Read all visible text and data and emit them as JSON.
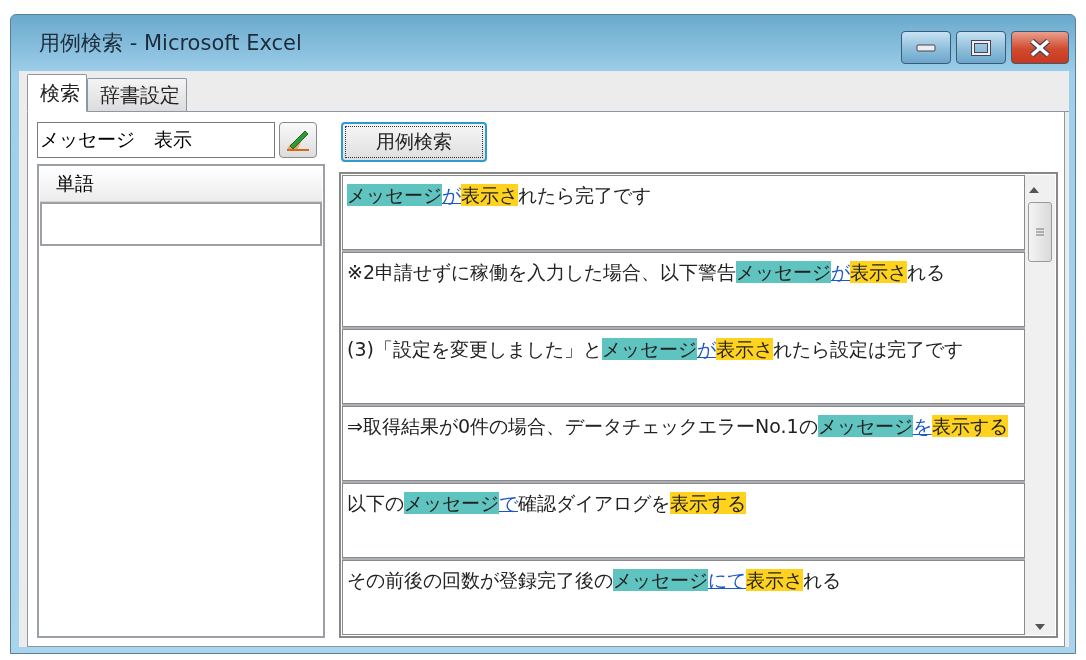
{
  "window": {
    "title": "用例検索 - Microsoft Excel"
  },
  "tabs": [
    {
      "label": "検索",
      "selected": true
    },
    {
      "label": "辞書設定",
      "selected": false
    }
  ],
  "search": {
    "value": "メッセージ　表示"
  },
  "search_button": "用例検索",
  "word_list": {
    "columns": [
      "単語"
    ],
    "rows": [
      {
        "word": "",
        "selected": false
      }
    ]
  },
  "results": [
    {
      "segments": [
        {
          "kind": "noun",
          "text": "メッセージ"
        },
        {
          "kind": "particle",
          "text": "が"
        },
        {
          "kind": "verb",
          "text": "表示さ"
        },
        {
          "kind": "plain",
          "text": "れたら完了です"
        }
      ]
    },
    {
      "segments": [
        {
          "kind": "plain",
          "text": "※2申請せずに稼働を入力した場合、以下警告"
        },
        {
          "kind": "noun",
          "text": "メッセージ"
        },
        {
          "kind": "particle",
          "text": "が"
        },
        {
          "kind": "verb",
          "text": "表示さ"
        },
        {
          "kind": "plain",
          "text": "れる"
        }
      ]
    },
    {
      "segments": [
        {
          "kind": "plain",
          "text": "(3)「設定を変更しました」と"
        },
        {
          "kind": "noun",
          "text": "メッセージ"
        },
        {
          "kind": "particle",
          "text": "が"
        },
        {
          "kind": "verb",
          "text": "表示さ"
        },
        {
          "kind": "plain",
          "text": "れたら設定は完了です"
        }
      ]
    },
    {
      "segments": [
        {
          "kind": "plain",
          "text": "⇒取得結果が0件の場合、データチェックエラーNo.1の"
        },
        {
          "kind": "noun",
          "text": "メッセージ"
        },
        {
          "kind": "particle",
          "text": "を"
        },
        {
          "kind": "verb",
          "text": "表示する"
        }
      ]
    },
    {
      "segments": [
        {
          "kind": "plain",
          "text": "以下の"
        },
        {
          "kind": "noun",
          "text": "メッセージ"
        },
        {
          "kind": "particle",
          "text": "で"
        },
        {
          "kind": "plain",
          "text": "確認ダイアログを"
        },
        {
          "kind": "verb",
          "text": "表示する"
        }
      ]
    },
    {
      "segments": [
        {
          "kind": "plain",
          "text": "その前後の回数が登録完了後の"
        },
        {
          "kind": "noun",
          "text": "メッセージ"
        },
        {
          "kind": "particle",
          "text": "にて"
        },
        {
          "kind": "verb",
          "text": "表示さ"
        },
        {
          "kind": "plain",
          "text": "れる"
        }
      ]
    }
  ]
}
